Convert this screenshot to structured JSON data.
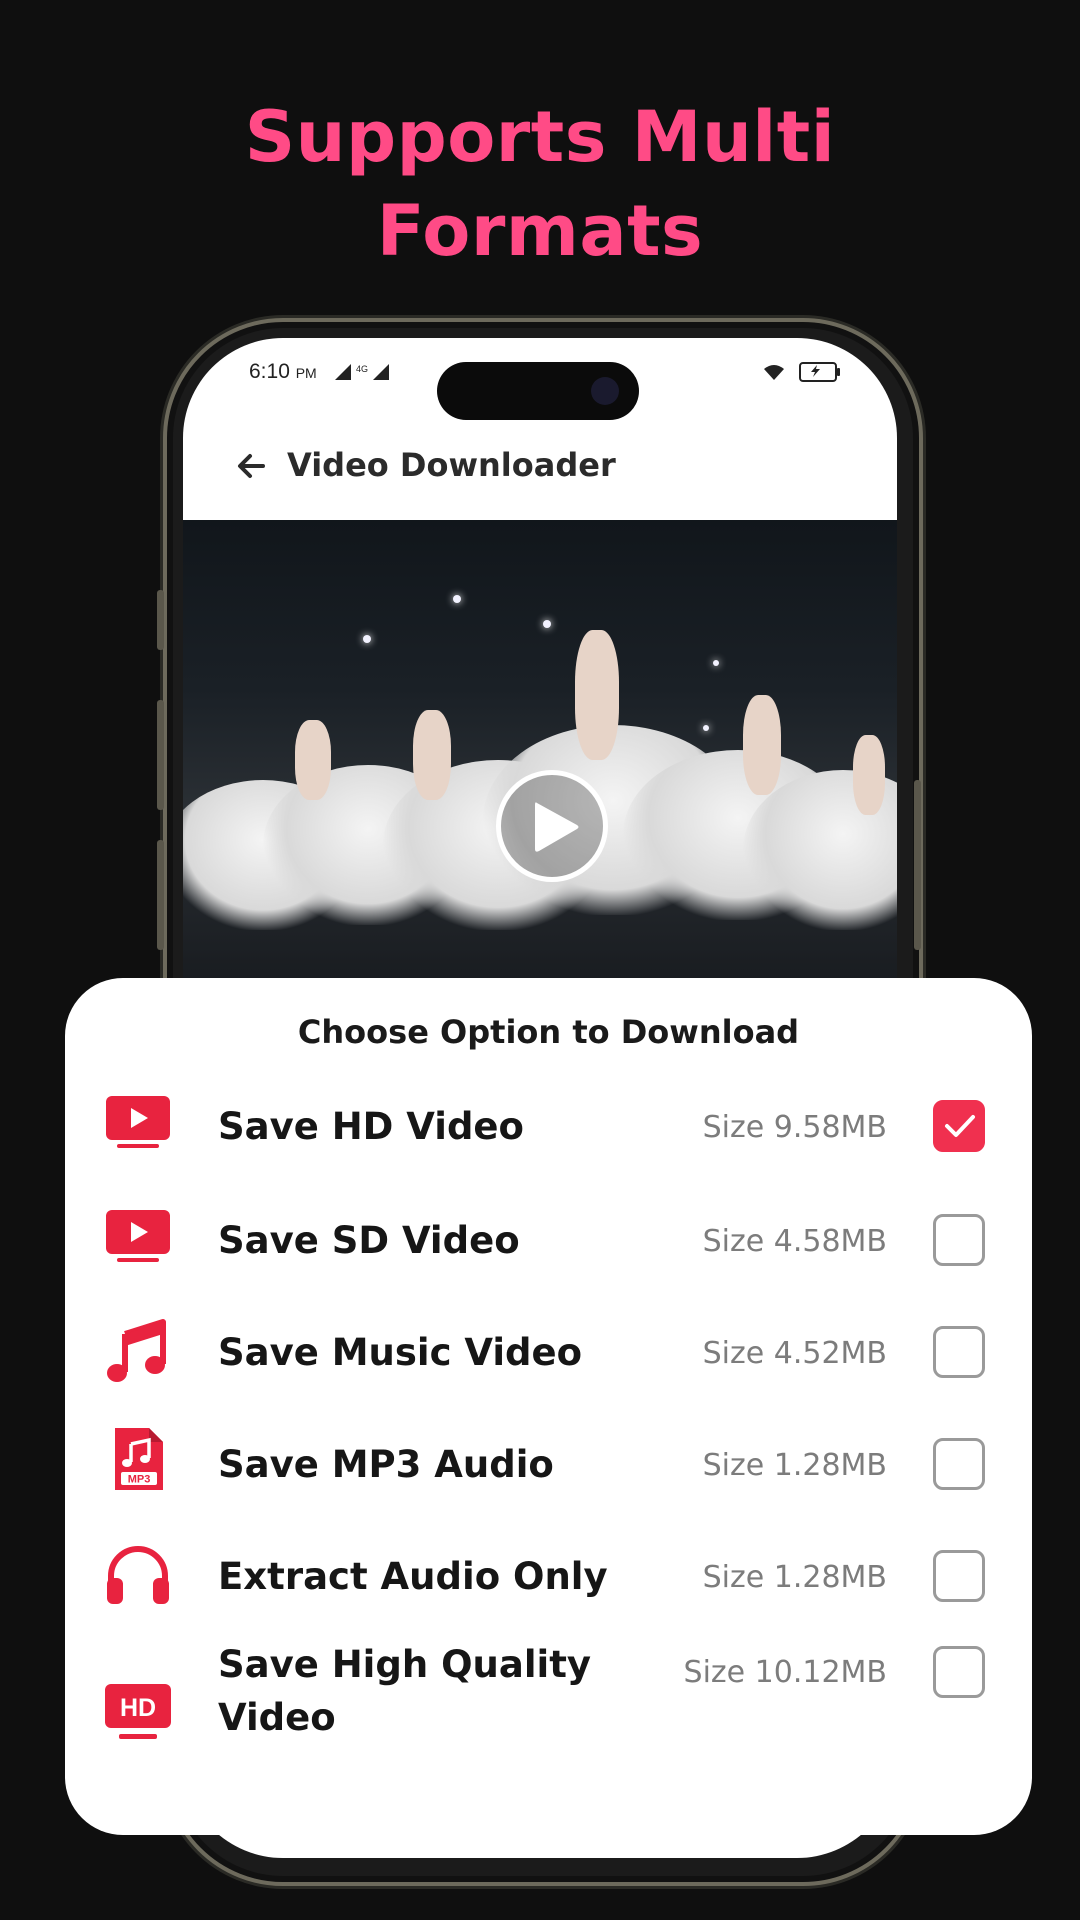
{
  "headline": {
    "line1": "Supports Multi",
    "line2": "Formats"
  },
  "status_bar": {
    "time": "6:10",
    "ampm": "PM",
    "network": "4G"
  },
  "app_bar": {
    "title": "Video Downloader"
  },
  "sheet": {
    "title": "Choose Option to Download",
    "options": [
      {
        "label": "Save HD Video",
        "size": "Size 9.58MB",
        "checked": true,
        "icon": "youtube-tv-icon"
      },
      {
        "label": "Save SD Video",
        "size": "Size 4.58MB",
        "checked": false,
        "icon": "youtube-tv-icon"
      },
      {
        "label": "Save Music Video",
        "size": "Size 4.52MB",
        "checked": false,
        "icon": "music-note-icon"
      },
      {
        "label": "Save MP3 Audio",
        "size": "Size 1.28MB",
        "checked": false,
        "icon": "mp3-file-icon",
        "icon_text": "MP3"
      },
      {
        "label": "Extract Audio Only",
        "size": "Size 1.28MB",
        "checked": false,
        "icon": "headphones-icon"
      },
      {
        "label": "Save High Quality Video",
        "size": "Size 10.12MB",
        "checked": false,
        "icon": "hd-tv-icon",
        "icon_text": "HD"
      }
    ]
  },
  "colors": {
    "accent": "#ff4b86",
    "check": "#f0304f",
    "icon_red": "#e8233f",
    "background": "#0f0f0f"
  }
}
